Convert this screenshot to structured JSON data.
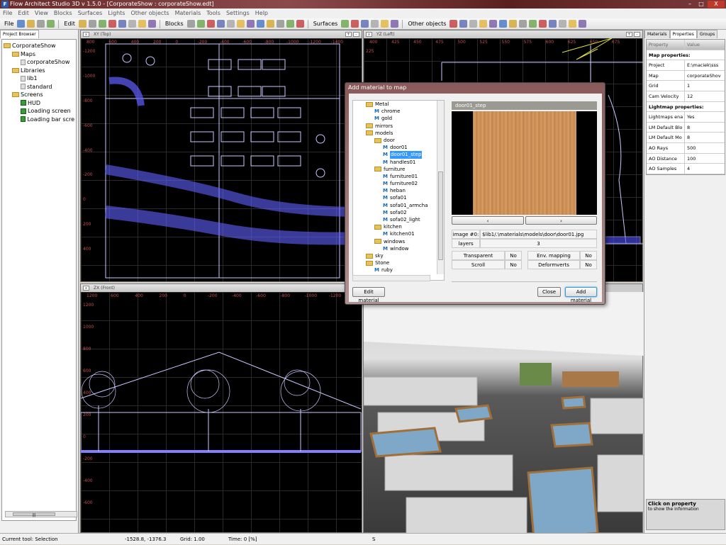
{
  "window": {
    "title": "Flow Architect Studio 3D v 1.5.0  - [CorporateShow : corporateShow.edt]",
    "logo": "F",
    "minimize": "–",
    "maximize": "□",
    "close": "X"
  },
  "menu": [
    "File",
    "Edit",
    "View",
    "Blocks",
    "Surfaces",
    "Lights",
    "Other objects",
    "Materials",
    "Tools",
    "Settings",
    "Help"
  ],
  "toolbar": {
    "groups": [
      "File",
      "Edit",
      "Blocks",
      "Surfaces",
      "Other objects"
    ]
  },
  "left_panel": {
    "tab": "Project Browser",
    "tree": [
      {
        "label": "CorporateShow",
        "level": 0,
        "icon": "folder-icon"
      },
      {
        "label": "Maps",
        "level": 1,
        "icon": "folder-icon"
      },
      {
        "label": "corporateShow",
        "level": 2,
        "icon": "map-file-icon"
      },
      {
        "label": "Libraries",
        "level": 1,
        "icon": "folder-icon"
      },
      {
        "label": "lib1",
        "level": 2,
        "icon": "library-icon"
      },
      {
        "label": "standard",
        "level": 2,
        "icon": "library-icon"
      },
      {
        "label": "Screens",
        "level": 1,
        "icon": "folder-icon"
      },
      {
        "label": "HUD",
        "level": 2,
        "icon": "screen-icon"
      },
      {
        "label": "Loading screen",
        "level": 2,
        "icon": "screen-icon"
      },
      {
        "label": "Loading bar scre",
        "level": 2,
        "icon": "screen-icon"
      }
    ],
    "scroll_grip": "|||"
  },
  "viewports": {
    "xy": {
      "title": "XY (Top)",
      "close": "x",
      "plus": "+",
      "minus": "-",
      "xticks": [
        "800",
        "600",
        "400",
        "200",
        "0",
        "-200",
        "-400",
        "-600",
        "-800",
        "-1000",
        "-1200",
        "-1400"
      ],
      "yticks": [
        "-1200",
        "-1000",
        "-800",
        "-600",
        "-400",
        "-200",
        "0",
        "200",
        "400"
      ]
    },
    "yz": {
      "title": "YZ (Left)",
      "close": "x",
      "plus": "+",
      "minus": "-",
      "xticks": [
        "400",
        "425",
        "450",
        "475",
        "500",
        "525",
        "550",
        "575",
        "600",
        "625",
        "650",
        "675"
      ],
      "yticks": [
        "225"
      ]
    },
    "zx": {
      "title": "ZX (Front)",
      "close": "x",
      "plus": "+",
      "minus": "-",
      "xticks": [
        "1200",
        "600",
        "400",
        "200",
        "0",
        "-200",
        "-400",
        "-600",
        "-800",
        "-1000",
        "-1200"
      ],
      "yticks": [
        "1200",
        "1000",
        "800",
        "600",
        "400",
        "200",
        "0",
        "-200",
        "-400",
        "-600"
      ]
    },
    "persp": {
      "title": ""
    }
  },
  "dialog": {
    "title": "Add material to map",
    "tree": [
      {
        "label": "Metal",
        "level": 0,
        "type": "folder"
      },
      {
        "label": "chrome",
        "level": 1,
        "type": "material"
      },
      {
        "label": "gold",
        "level": 1,
        "type": "material"
      },
      {
        "label": "mirrors",
        "level": 0,
        "type": "folder"
      },
      {
        "label": "models",
        "level": 0,
        "type": "folder"
      },
      {
        "label": "door",
        "level": 1,
        "type": "folder"
      },
      {
        "label": "door01",
        "level": 2,
        "type": "material"
      },
      {
        "label": "door01_step",
        "level": 2,
        "type": "material",
        "selected": true
      },
      {
        "label": "handles01",
        "level": 2,
        "type": "material"
      },
      {
        "label": "furniture",
        "level": 1,
        "type": "folder"
      },
      {
        "label": "furniture01",
        "level": 2,
        "type": "material"
      },
      {
        "label": "furniture02",
        "level": 2,
        "type": "material"
      },
      {
        "label": "heban",
        "level": 2,
        "type": "material"
      },
      {
        "label": "sofa01",
        "level": 2,
        "type": "material"
      },
      {
        "label": "sofa01_armcha",
        "level": 2,
        "type": "material"
      },
      {
        "label": "sofa02",
        "level": 2,
        "type": "material"
      },
      {
        "label": "sofa02_light",
        "level": 2,
        "type": "material"
      },
      {
        "label": "kitchen",
        "level": 1,
        "type": "folder"
      },
      {
        "label": "kitchen01",
        "level": 2,
        "type": "material"
      },
      {
        "label": "windows",
        "level": 1,
        "type": "folder"
      },
      {
        "label": "window",
        "level": 2,
        "type": "material"
      },
      {
        "label": "sky",
        "level": 0,
        "type": "folder"
      },
      {
        "label": "Stone",
        "level": 0,
        "type": "folder"
      },
      {
        "label": "ruby",
        "level": 1,
        "type": "material"
      }
    ],
    "material_icon": "M",
    "preview_title": "door01_step",
    "prev": "‹",
    "next": "›",
    "image_label": "image #0:",
    "image_path": "$lib1/.\\materials\\models\\door\\door01.jpg",
    "layers_label": "layers",
    "layers_value": "3",
    "transparent_label": "Transparent",
    "transparent_value": "No",
    "env_label": "Env. mapping",
    "env_value": "No",
    "scroll_label": "Scroll",
    "scroll_value": "No",
    "deform_label": "Deformverts",
    "deform_value": "No",
    "edit_button": "Edit material",
    "close_button": "Close",
    "add_button": "Add material"
  },
  "right_panel": {
    "tabs": [
      "Materials",
      "Properties",
      "Groups"
    ],
    "active_tab": "Properties",
    "header": {
      "property": "Property",
      "value": "Value"
    },
    "map_section": "Map properties:",
    "map_props": [
      {
        "k": "Project",
        "v": "E:\\maciek\\sss"
      },
      {
        "k": "Map",
        "v": "corporateShov"
      },
      {
        "k": "Grid",
        "v": "1"
      },
      {
        "k": "Cam Velocity",
        "v": "12"
      }
    ],
    "lightmap_section": "Lightmap properties:",
    "lightmap_props": [
      {
        "k": "Lightmaps ena",
        "v": "Yes"
      },
      {
        "k": "LM Default Blo",
        "v": "8"
      },
      {
        "k": "LM Default Mo",
        "v": "8"
      },
      {
        "k": "AO Rays",
        "v": "500"
      },
      {
        "k": "AO Distance",
        "v": "100"
      },
      {
        "k": "AO Samples",
        "v": "4"
      }
    ],
    "info_title": "Click on property",
    "info_text": "to show the information"
  },
  "status": {
    "tool": "Current tool:  Selection",
    "coords": "-1528.8, -1376.3",
    "grid": "Grid: 1.00",
    "time": "Time: 0 [%]",
    "extra": "S"
  }
}
